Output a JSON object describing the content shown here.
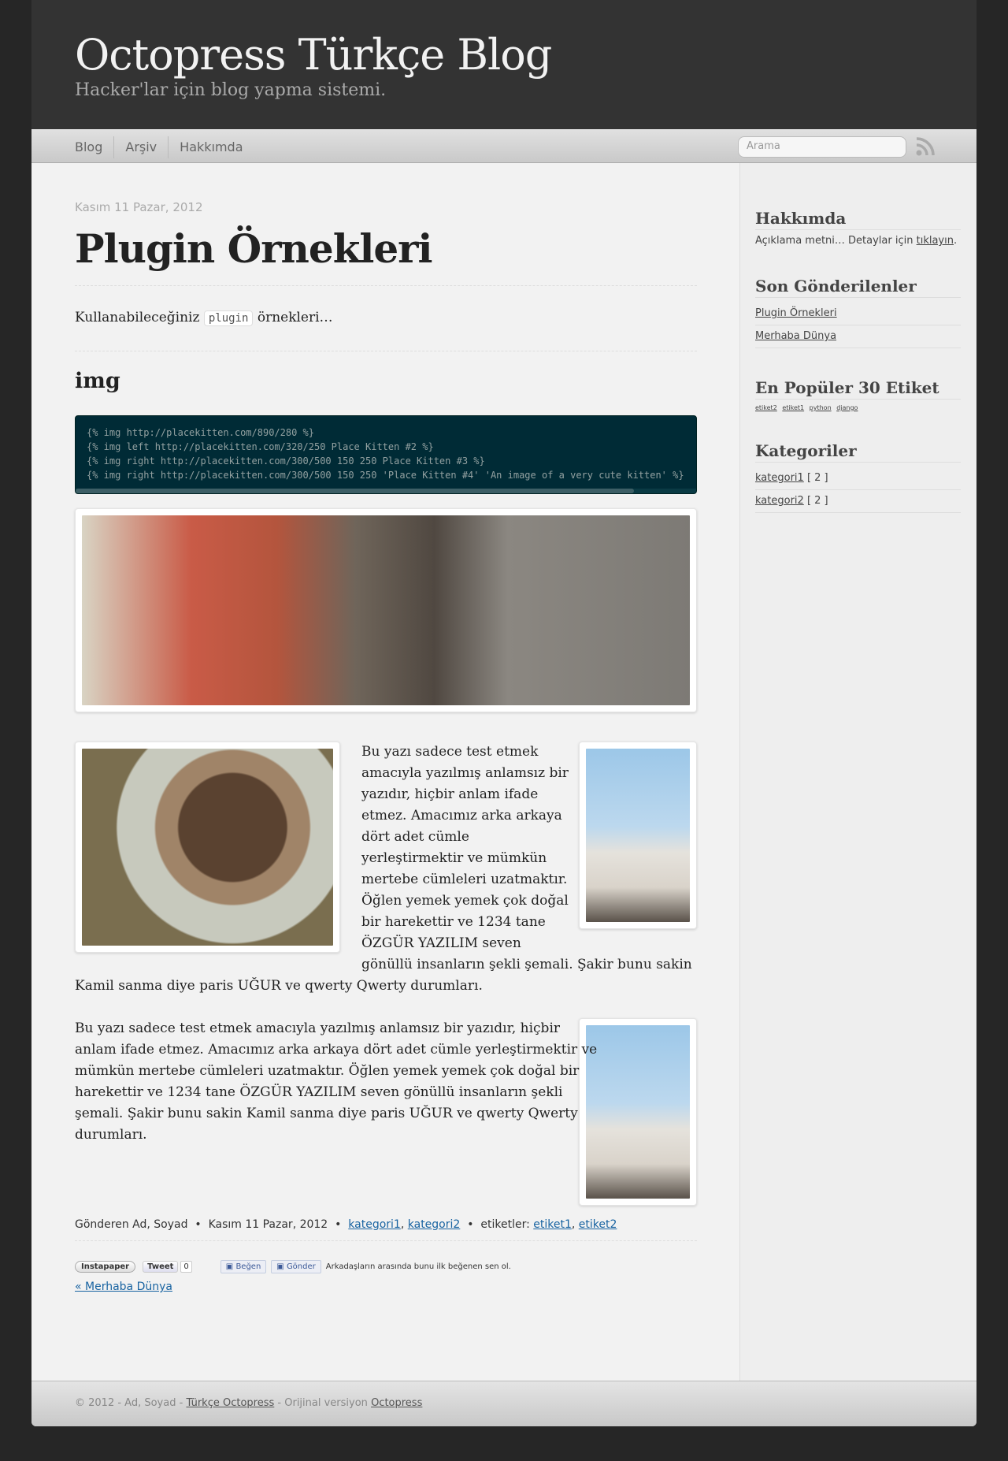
{
  "header": {
    "title": "Octopress Türkçe Blog",
    "subtitle": "Hacker'lar için blog yapma sistemi."
  },
  "nav": {
    "items": [
      "Blog",
      "Arşiv",
      "Hakkımda"
    ],
    "search_placeholder": "Arama"
  },
  "post": {
    "date": "Kasım 11 Pazar, 2012",
    "title": "Plugin Örnekleri",
    "intro_before": "Kullanabileceğiniz",
    "intro_code": "plugin",
    "intro_after": "örnekleri…",
    "section_heading": "img",
    "code_lines": [
      "{% img http://placekitten.com/890/280 %}",
      "{% img left http://placekitten.com/320/250 Place Kitten #2 %}",
      "{% img right http://placekitten.com/300/500 150 250 Place Kitten #3 %}",
      "{% img right http://placekitten.com/300/500 150 250 'Place Kitten #4' 'An image of a very cute kitten' %}"
    ],
    "paragraph1_lines": [
      "Bu yazı sadece test etmek",
      "amacıyla yazılmış anlamsız bir",
      "yazıdır, hiçbir anlam ifade",
      "etmez. Amacımız arka arkaya",
      "dört adet cümle",
      "yerleştirmektir ve mümkün",
      "mertebe cümleleri uzatmaktır.",
      "Öğlen yemek yemek çok doğal",
      "bir harekettir ve 1234 tane",
      "ÖZGÜR YAZILIM seven",
      "gönüllü insanların şekli şemali. Şakir bunu sakin",
      "Kamil sanma diye paris UĞUR ve qwerty Qwerty durumları."
    ],
    "paragraph2_lines": [
      "Bu yazı sadece test etmek amacıyla yazılmış anlamsız bir yazıdır, hiçbir",
      "anlam ifade etmez. Amacımız arka arkaya dört adet cümle yerleştirmektir ve",
      "mümkün mertebe cümleleri uzatmaktır. Öğlen yemek yemek çok doğal bir",
      "harekettir ve 1234 tane ÖZGÜR YAZILIM seven gönüllü insanların şekli",
      "şemali. Şakir bunu sakin Kamil sanma diye paris UĞUR ve qwerty Qwerty",
      "durumları."
    ],
    "meta": {
      "author": "Gönderen Ad, Soyad",
      "date": "Kasım 11 Pazar, 2012",
      "categories": [
        "kategori1",
        "kategori2"
      ],
      "tags_label": "etiketler:",
      "tags": [
        "etiket1",
        "etiket2"
      ]
    },
    "sharing": {
      "instapaper": "Instapaper",
      "tweet": "Tweet",
      "tweet_count": "0",
      "like": "Beğen",
      "send": "Gönder",
      "fb_text": "Arkadaşların arasında bunu ilk beğenen sen ol."
    },
    "prev_link": "« Merhaba Dünya"
  },
  "sidebar": {
    "about_heading": "Hakkımda",
    "about_text": "Açıklama metni… Detaylar için",
    "about_link": "tıklayın",
    "recent_heading": "Son Gönderilenler",
    "recent": [
      "Plugin Örnekleri",
      "Merhaba Dünya"
    ],
    "tags_heading": "En Popüler 30 Etiket",
    "tags": [
      "etiket2",
      "etiket1",
      "python",
      "django"
    ],
    "categories_heading": "Kategoriler",
    "categories": [
      {
        "name": "kategori1",
        "count": "[ 2 ]"
      },
      {
        "name": "kategori2",
        "count": "[ 2 ]"
      }
    ]
  },
  "footer": {
    "prefix": "© 2012 - Ad, Soyad -",
    "link1": "Türkçe Octopress",
    "middle": "- Orijinal versiyon",
    "link2": "Octopress"
  }
}
